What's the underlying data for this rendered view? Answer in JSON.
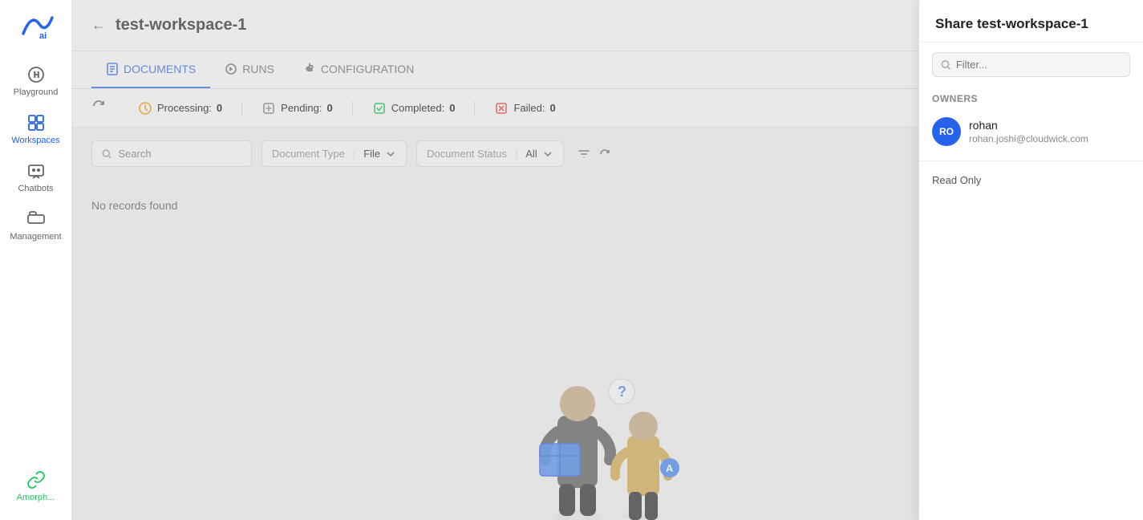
{
  "app": {
    "logo_text": "ai"
  },
  "sidebar": {
    "items": [
      {
        "id": "playground",
        "label": "Playground",
        "active": false
      },
      {
        "id": "workspaces",
        "label": "Workspaces",
        "active": true
      },
      {
        "id": "chatbots",
        "label": "Chatbots",
        "active": false
      },
      {
        "id": "management",
        "label": "Management",
        "active": false
      }
    ],
    "bottom_items": [
      {
        "id": "amorph",
        "label": "Amorph...",
        "active": false
      }
    ]
  },
  "header": {
    "back_label": "←",
    "title": "test-workspace-1"
  },
  "tabs": [
    {
      "id": "documents",
      "label": "DOCUMENTS",
      "active": true
    },
    {
      "id": "runs",
      "label": "RUNS",
      "active": false
    },
    {
      "id": "configuration",
      "label": "CONFIGURATION",
      "active": false
    }
  ],
  "status_bar": {
    "processing_label": "Processing:",
    "processing_value": "0",
    "pending_label": "Pending:",
    "pending_value": "0",
    "completed_label": "Completed:",
    "completed_value": "0",
    "failed_label": "Failed:",
    "failed_value": "0"
  },
  "filters": {
    "search_placeholder": "Search",
    "doc_type_label": "Document Type",
    "doc_type_value": "File",
    "doc_status_label": "Document Status",
    "doc_status_value": "All"
  },
  "empty_state": {
    "text": "No records found"
  },
  "panel": {
    "title": "Share test-workspace-1",
    "search_placeholder": "Filter...",
    "owners_label": "Owners",
    "owner": {
      "initials": "RO",
      "name": "rohan",
      "email": "rohan.joshi@cloudwick.com"
    },
    "read_only_label": "Read Only"
  }
}
